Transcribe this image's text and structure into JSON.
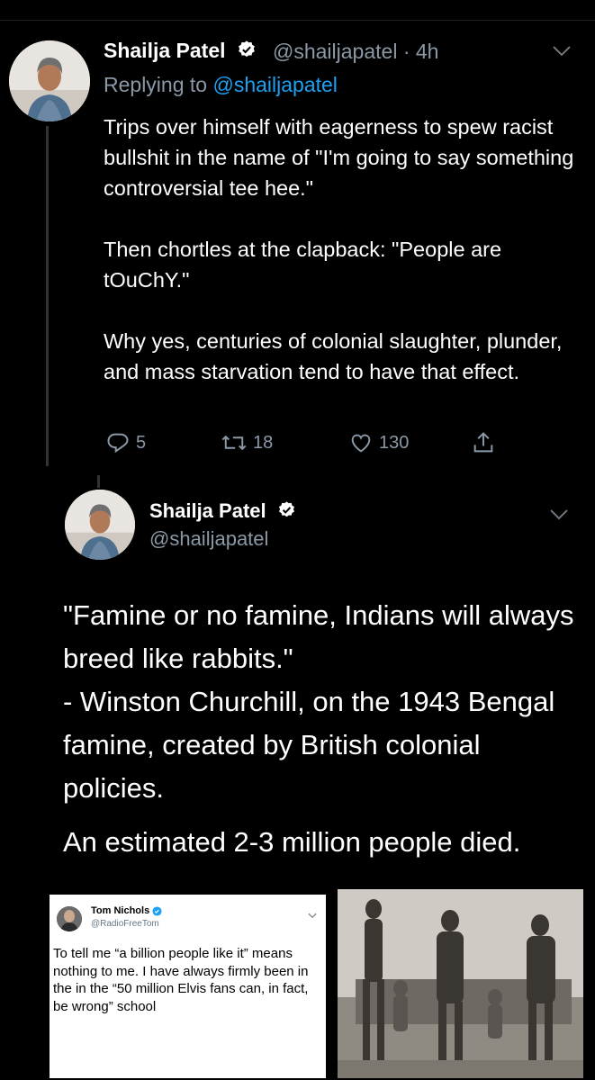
{
  "tweet": {
    "name": "Shailja Patel",
    "handle_time": "@shailjapatel · 4h",
    "replying_prefix": "Replying to ",
    "replying_handle": "@shailjapatel",
    "paragraphs": [
      "Trips over himself with eagerness to spew racist bullshit in the name of \"I'm going to say something controversial tee hee.\"",
      "Then chortles at the clapback: \"People are tOuChY.\"",
      "Why yes, centuries of colonial slaughter, plunder, and mass starvation tend to have that effect."
    ],
    "actions": {
      "reply_count": "5",
      "retweet_count": "18",
      "like_count": "130"
    }
  },
  "quoted": {
    "name": "Shailja Patel",
    "handle": "@shailjapatel",
    "paragraphs": [
      "\"Famine or no famine, Indians will always breed like rabbits.\"",
      "- Winston Churchill, on the 1943 Bengal famine, created by British colonial policies.",
      "An estimated 2-3 million people died."
    ]
  },
  "embedded_card": {
    "name": "Tom Nichols",
    "handle": "@RadioFreeTom",
    "text": "To tell me “a billion people like it” means nothing to me. I have always firmly been in the in the “50 million Elvis fans can, in fact, be wrong” school"
  },
  "icons": {
    "verified": "verified-badge-icon",
    "caret": "chevron-down-icon",
    "reply": "reply-icon",
    "retweet": "retweet-icon",
    "like": "heart-icon",
    "share": "share-icon"
  },
  "colors": {
    "background": "#000000",
    "muted": "#8b98a5",
    "link": "#1da1f2",
    "verified": "#ffffff"
  }
}
